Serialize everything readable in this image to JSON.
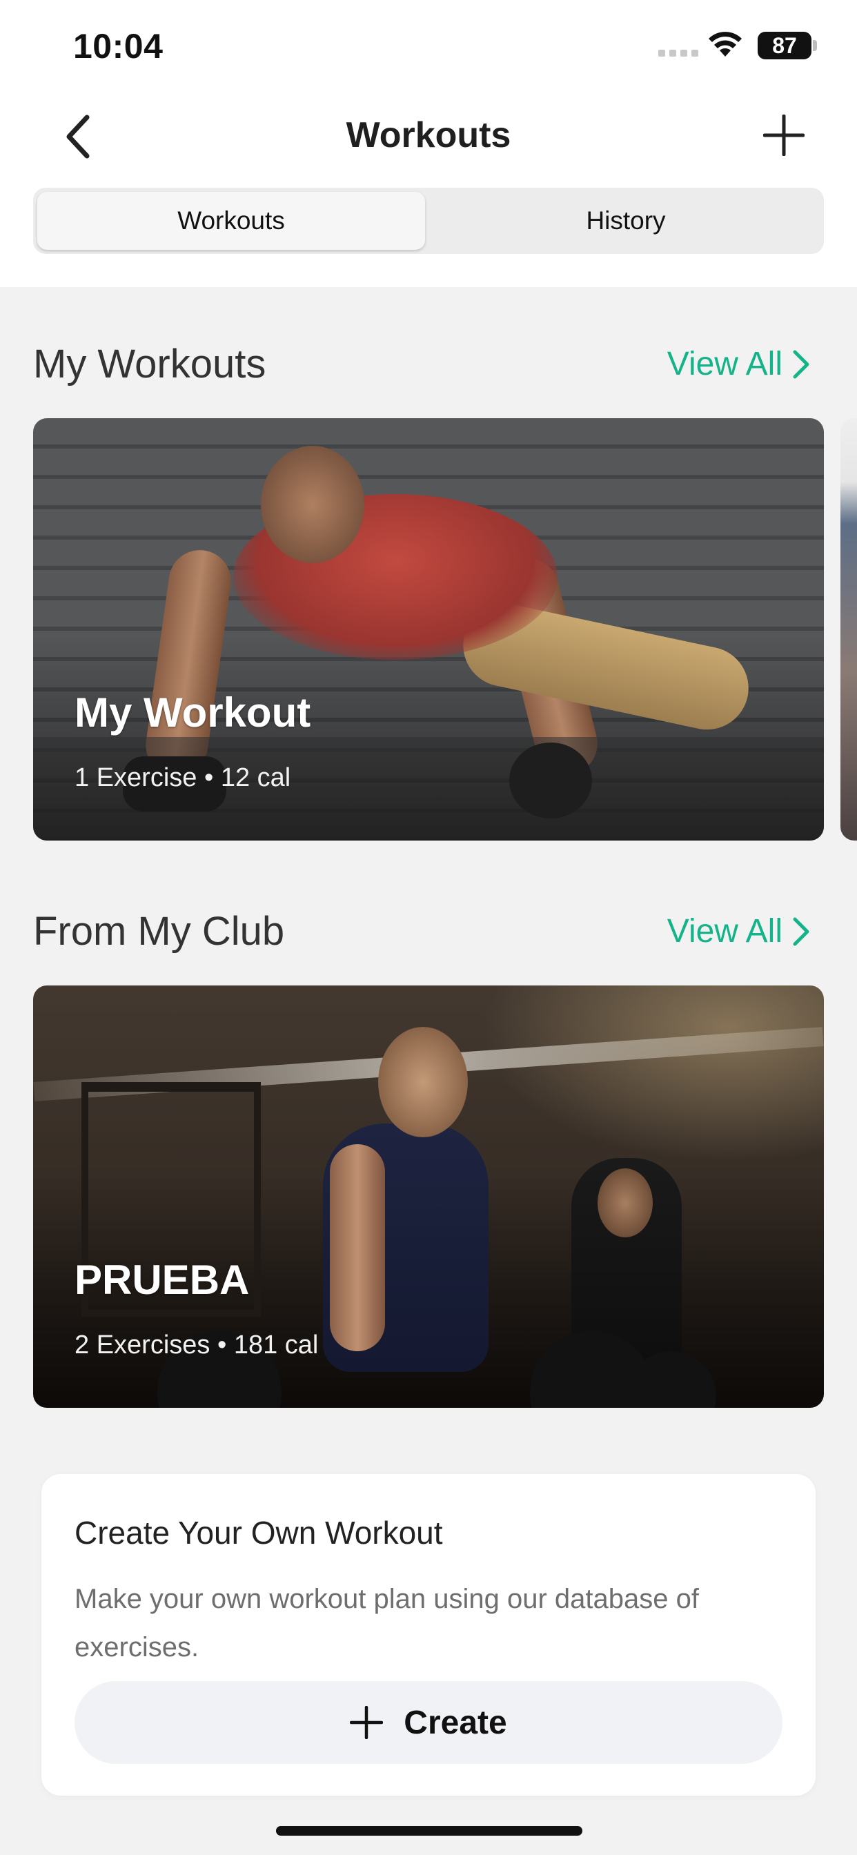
{
  "status_bar": {
    "time": "10:04",
    "battery": "87"
  },
  "nav": {
    "title": "Workouts",
    "back_icon": "chevron-left-icon",
    "add_icon": "plus-icon"
  },
  "segments": {
    "items": [
      {
        "label": "Workouts",
        "selected": true
      },
      {
        "label": "History",
        "selected": false
      }
    ]
  },
  "my_workouts": {
    "title": "My Workouts",
    "view_all": "View All",
    "cards": [
      {
        "title": "My Workout",
        "subtitle": "1 Exercise • 12 cal"
      }
    ]
  },
  "from_my_club": {
    "title": "From My Club",
    "view_all": "View All",
    "cards": [
      {
        "title": "PRUEBA",
        "subtitle": "2 Exercises • 181 cal"
      }
    ]
  },
  "create": {
    "title": "Create Your Own Workout",
    "description": "Make your own workout plan using our database of exercises.",
    "button_label": "Create"
  },
  "colors": {
    "accent": "#14b38a",
    "background": "#f2f2f2"
  }
}
